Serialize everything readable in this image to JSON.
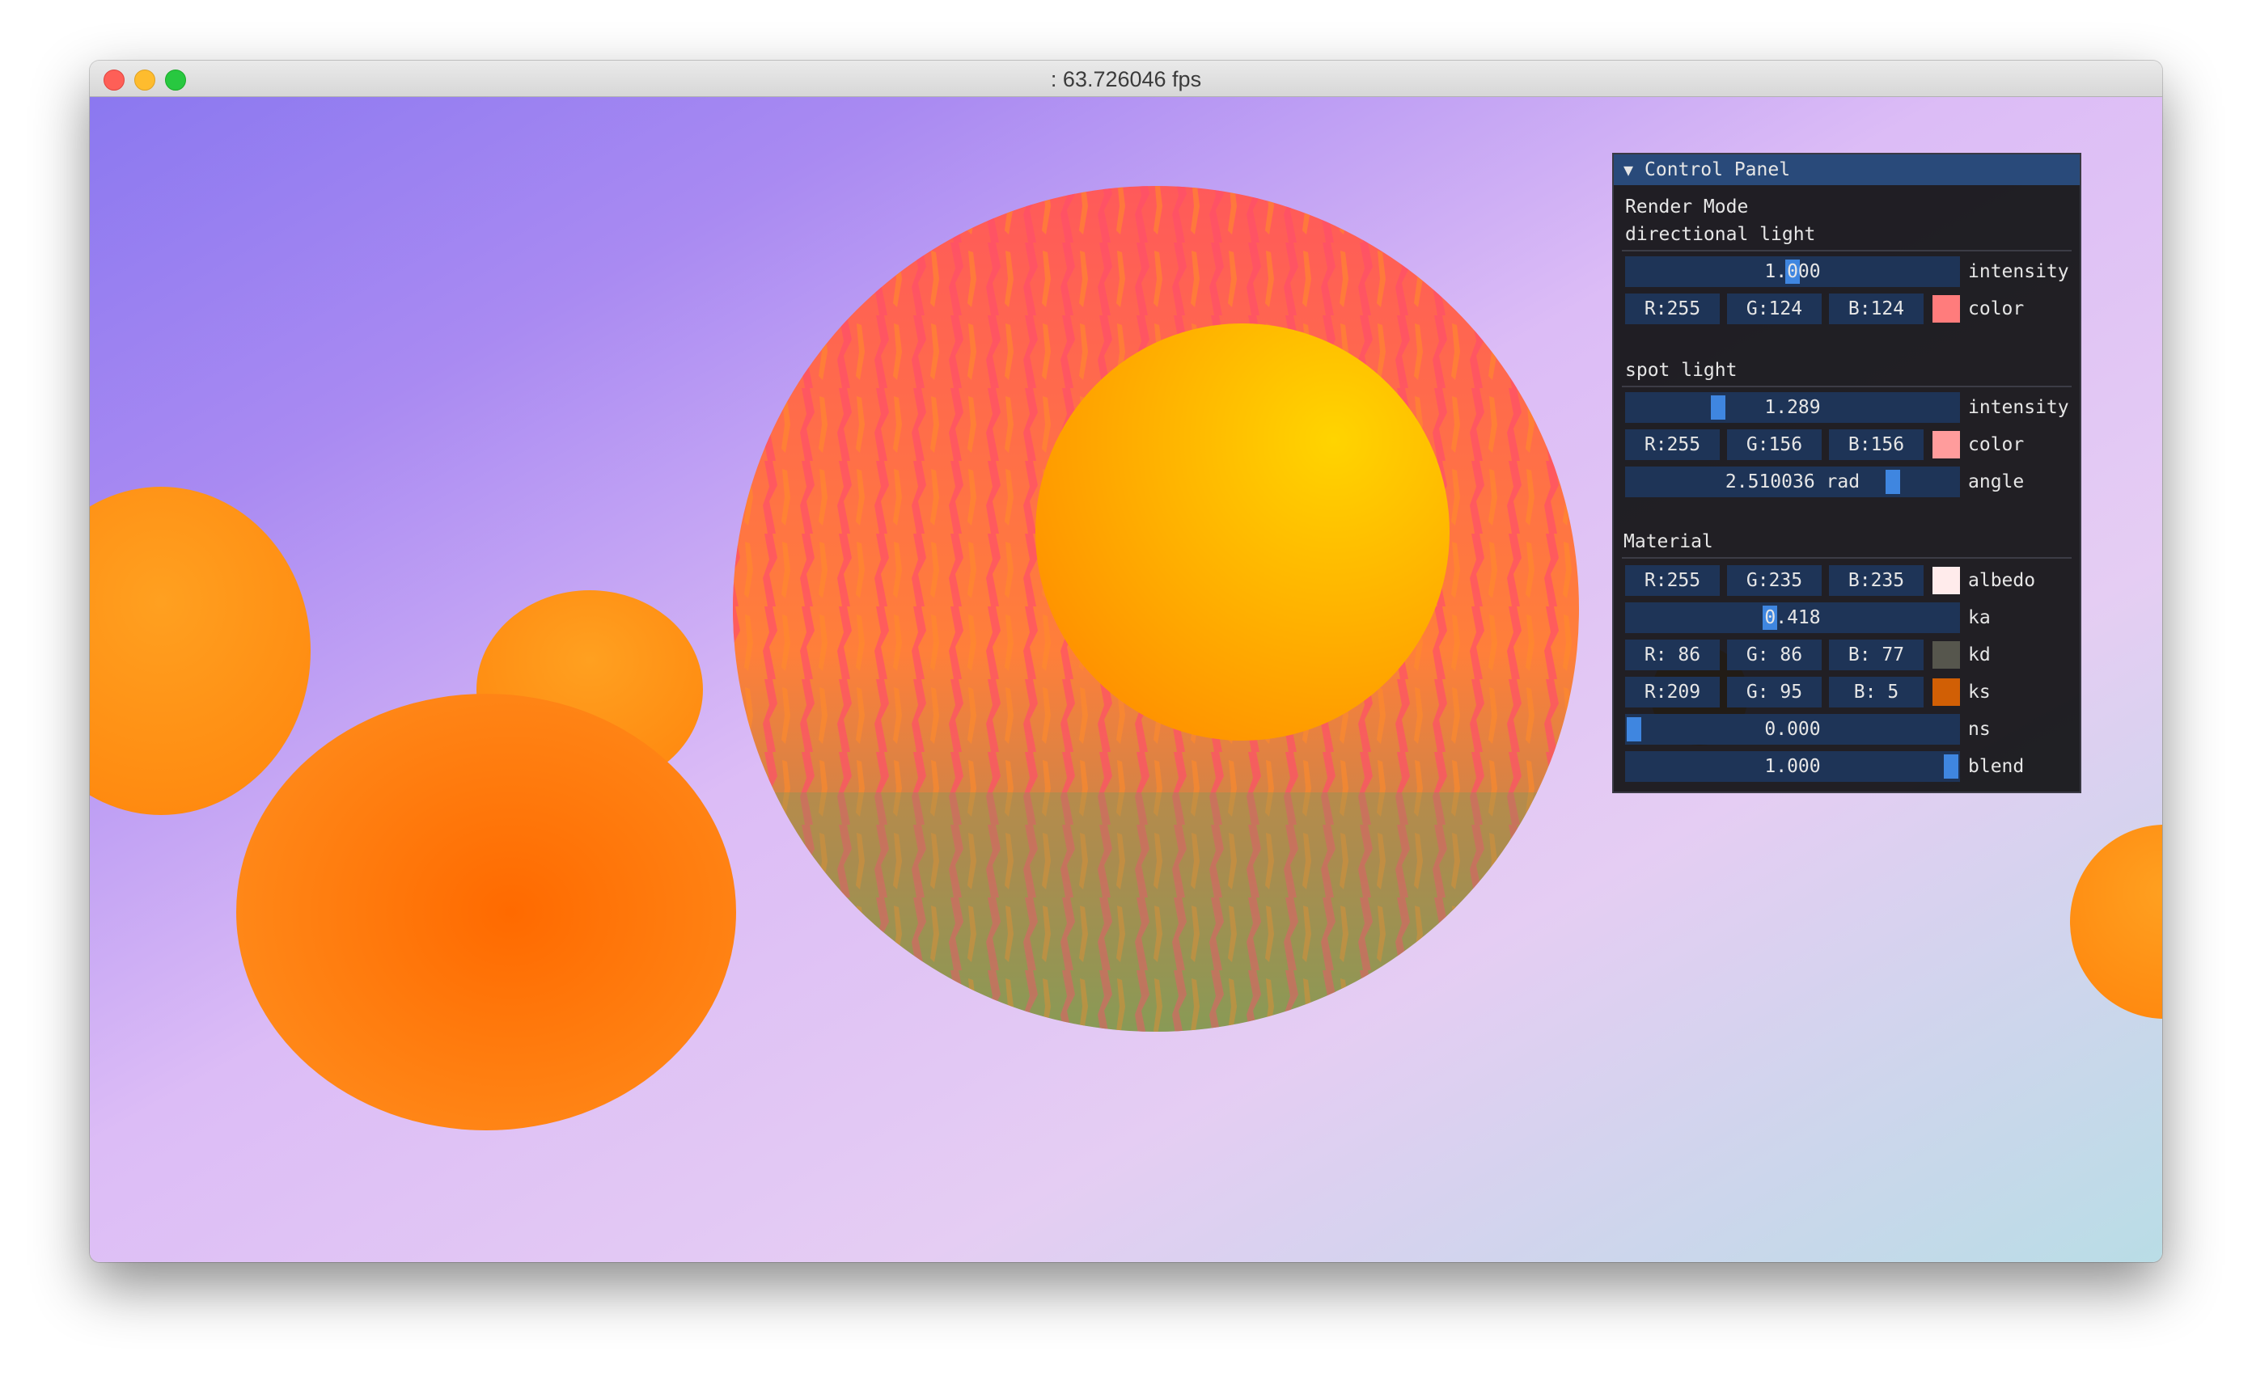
{
  "window": {
    "title": ": 63.726046 fps"
  },
  "panel": {
    "header": "Control Panel",
    "render_mode_label": "Render Mode",
    "directional": {
      "heading": "directional light",
      "intensity": {
        "value": "1.000",
        "label": "intensity",
        "level": 0.5
      },
      "color": {
        "r": "R:255",
        "g": "G:124",
        "b": "B:124",
        "hex": "#ff7c7c",
        "label": "color"
      }
    },
    "spot": {
      "heading": "spot light",
      "intensity": {
        "value": "1.289",
        "label": "intensity",
        "level": 0.26
      },
      "color": {
        "r": "R:255",
        "g": "G:156",
        "b": "B:156",
        "hex": "#ff9c9c",
        "label": "color"
      },
      "angle": {
        "value": "2.510036 rad",
        "label": "angle",
        "level": 0.8
      }
    },
    "material": {
      "heading": "Material",
      "albedo": {
        "r": "R:255",
        "g": "G:235",
        "b": "B:235",
        "hex": "#ffebeb",
        "label": "albedo"
      },
      "ka": {
        "value": "0.418",
        "label": "ka",
        "level": 0.418
      },
      "kd": {
        "r": "R: 86",
        "g": "G: 86",
        "b": "B: 77",
        "hex": "#56564d",
        "label": "kd"
      },
      "ks": {
        "r": "R:209",
        "g": "G: 95",
        "b": "B:  5",
        "hex": "#d15f05",
        "label": "ks"
      },
      "ns": {
        "value": "0.000",
        "label": "ns",
        "level": 0.0
      },
      "blend": {
        "value": "1.000",
        "label": "blend",
        "level": 1.0
      }
    }
  },
  "icons": {
    "collapse": "triangle-down-icon"
  }
}
